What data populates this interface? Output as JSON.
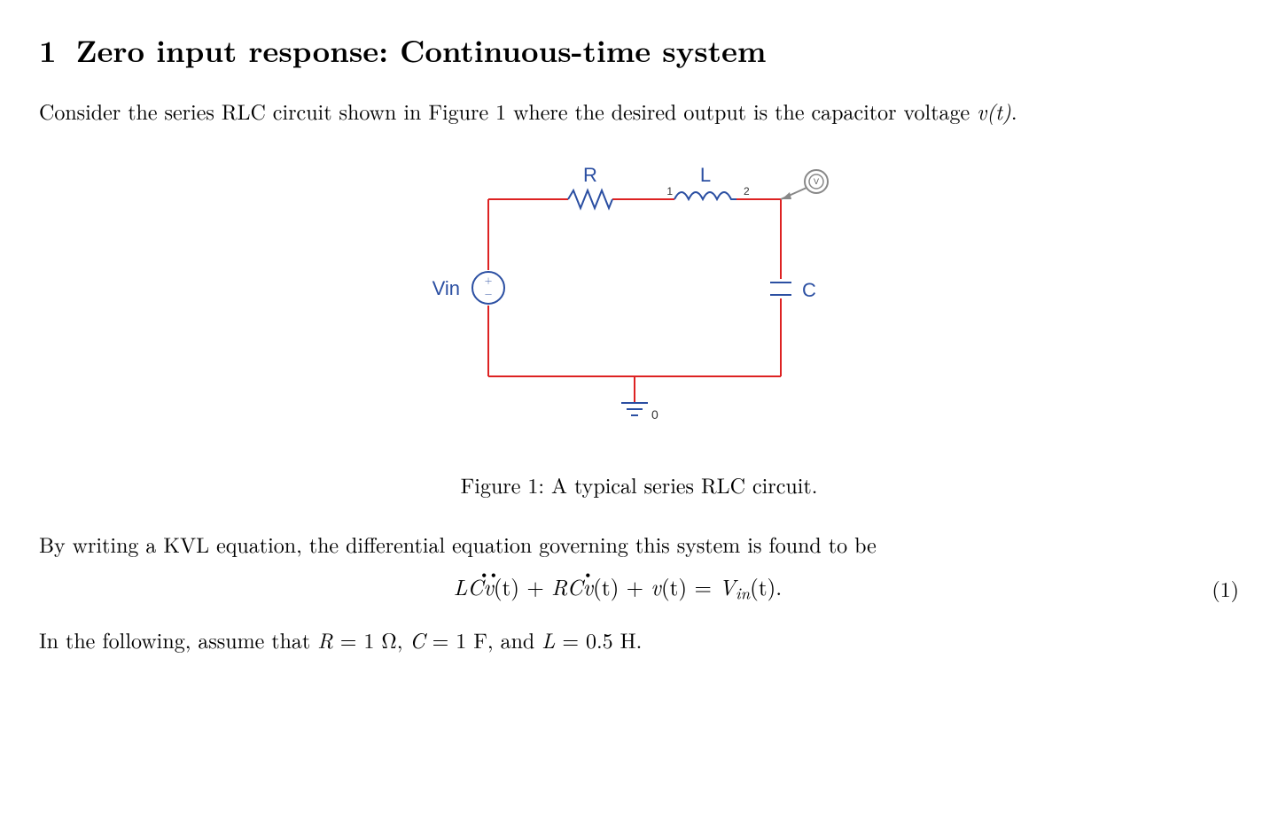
{
  "section": {
    "number": "1",
    "title": "Zero input response: Continuous-time system"
  },
  "intro": {
    "pre": "Consider the series RLC circuit shown in Figure 1 where the desired output is the capacitor voltage ",
    "var": "v(t)",
    "post": "."
  },
  "circuit": {
    "Vin": "Vin",
    "R": "R",
    "L": "L",
    "C": "C",
    "node1": "1",
    "node2": "2",
    "gnd": "0",
    "probe": "V"
  },
  "figure_caption": "Figure 1: A typical series RLC circuit.",
  "kvl_sentence": "By writing a KVL equation, the differential equation governing this system is found to be",
  "equation": {
    "LC": "LC",
    "v": "v",
    "RC": "RC",
    "eq": " = ",
    "Vin": "V",
    "in": "in",
    "t": "(t)",
    "plus": " + ",
    "period": ".",
    "number": "(1)"
  },
  "assumptions": {
    "pre": "In the following, assume that ",
    "R": "R",
    "Rval": " = 1 Ω, ",
    "C": "C",
    "Cval": " = 1 F, and ",
    "L": "L",
    "Lval": " = 0.5 H."
  }
}
